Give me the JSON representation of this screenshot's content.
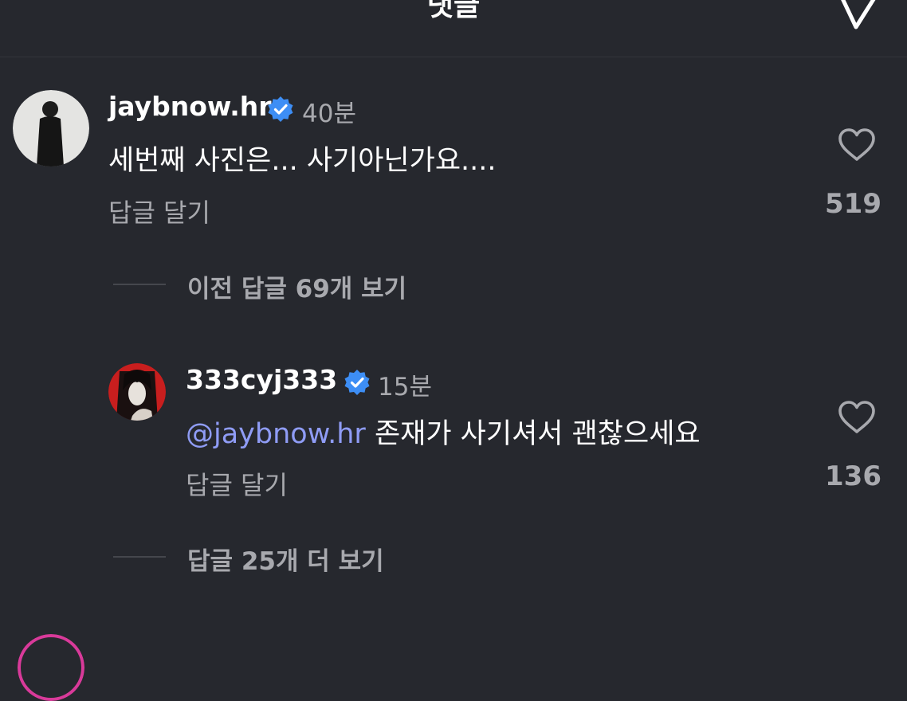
{
  "header": {
    "title": "댓글"
  },
  "comments": [
    {
      "username": "jaybnow.hr",
      "time": "40분",
      "text": "세번째 사진은... 사기아닌가요....",
      "reply_label": "답글 달기",
      "likes": "519",
      "view_replies": "이전 답글 69개 보기"
    },
    {
      "username": "333cyj333",
      "time": "15분",
      "mention": "@jaybnow.hr",
      "text": "존재가 사기셔서 괜찮으세요",
      "reply_label": "답글 달기",
      "likes": "136",
      "view_replies": "답글 25개 더 보기"
    }
  ],
  "colors": {
    "background": "#26282e",
    "verified": "#3d8ef5",
    "mention": "#8f9cf5",
    "muted": "#a8a9ae"
  }
}
